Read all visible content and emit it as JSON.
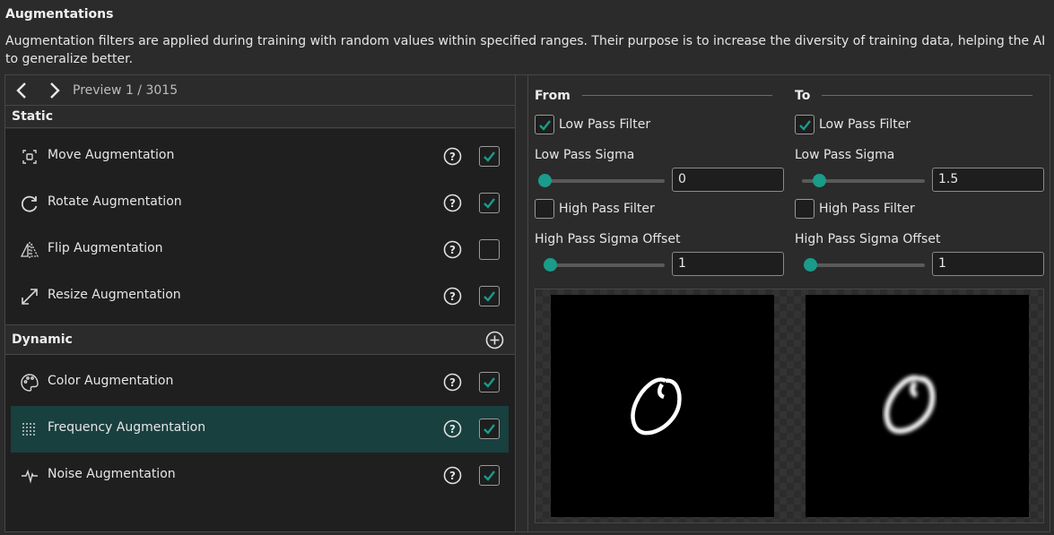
{
  "header": {
    "title": "Augmentations",
    "description": "Augmentation filters are applied during training with random values within specified ranges. Their purpose is to increase the diversity of training data, helping the AI to generalize better."
  },
  "preview": {
    "label": "Preview 1 / 3015",
    "prev_icon": "chevron-left-icon",
    "next_icon": "chevron-right-icon"
  },
  "static_section": {
    "title": "Static",
    "items": [
      {
        "label": "Move Augmentation",
        "icon": "move-icon",
        "checked": true
      },
      {
        "label": "Rotate Augmentation",
        "icon": "rotate-icon",
        "checked": true
      },
      {
        "label": "Flip Augmentation",
        "icon": "flip-icon",
        "checked": false
      },
      {
        "label": "Resize Augmentation",
        "icon": "resize-icon",
        "checked": true
      }
    ]
  },
  "dynamic_section": {
    "title": "Dynamic",
    "add_icon": "add-circle-icon",
    "items": [
      {
        "label": "Color Augmentation",
        "icon": "palette-icon",
        "checked": true,
        "selected": false
      },
      {
        "label": "Frequency Augmentation",
        "icon": "dots-grid-icon",
        "checked": true,
        "selected": true
      },
      {
        "label": "Noise Augmentation",
        "icon": "pulse-icon",
        "checked": true,
        "selected": false
      }
    ]
  },
  "from": {
    "title": "From",
    "low_pass_filter": {
      "label": "Low Pass Filter",
      "checked": true
    },
    "low_pass_sigma": {
      "label": "Low Pass Sigma",
      "value": "0",
      "slider_fraction": 0.0
    },
    "high_pass_filter": {
      "label": "High Pass Filter",
      "checked": false
    },
    "high_pass_sigma_offset": {
      "label": "High Pass Sigma Offset",
      "value": "1",
      "slider_fraction": 0.0
    }
  },
  "to": {
    "title": "To",
    "low_pass_filter": {
      "label": "Low Pass Filter",
      "checked": true
    },
    "low_pass_sigma": {
      "label": "Low Pass Sigma",
      "value": "1.5",
      "slider_fraction": 0.1
    },
    "high_pass_filter": {
      "label": "High Pass Filter",
      "checked": false
    },
    "high_pass_sigma_offset": {
      "label": "High Pass Sigma Offset",
      "value": "1",
      "slider_fraction": 0.0
    }
  },
  "colors": {
    "accent": "#1a9c8a",
    "selected_row": "#18403f",
    "background": "#2b2b2b"
  }
}
